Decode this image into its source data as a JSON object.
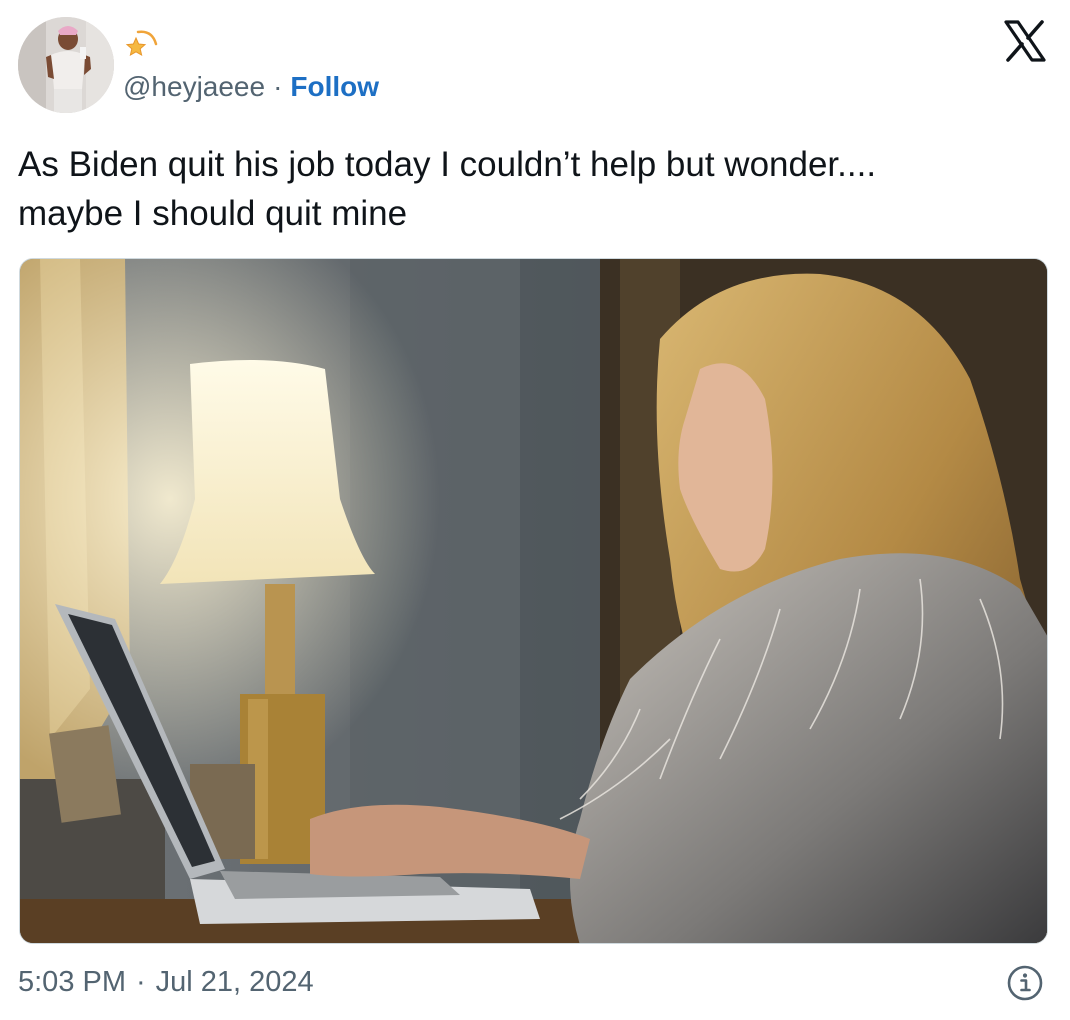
{
  "author": {
    "handle": "@heyjaeee",
    "separator": "·",
    "follow_label": "Follow",
    "badge_icon": "shooting-star-icon"
  },
  "header": {
    "platform_icon": "x-logo-icon"
  },
  "tweet": {
    "text_line_1": "As Biden quit his job today I couldn’t help but wonder....",
    "text_line_2": "maybe I should quit mine"
  },
  "media": {
    "kind": "photo",
    "subject": "woman typing on a laptop beside a lit lamp"
  },
  "footer": {
    "time": "5:03 PM",
    "separator": "·",
    "date": "Jul 21, 2024",
    "info_icon": "info-icon"
  },
  "colors": {
    "text_primary": "#0f1419",
    "text_secondary": "#536471",
    "follow_blue": "#1d6fc4",
    "border": "#cfd9de"
  }
}
